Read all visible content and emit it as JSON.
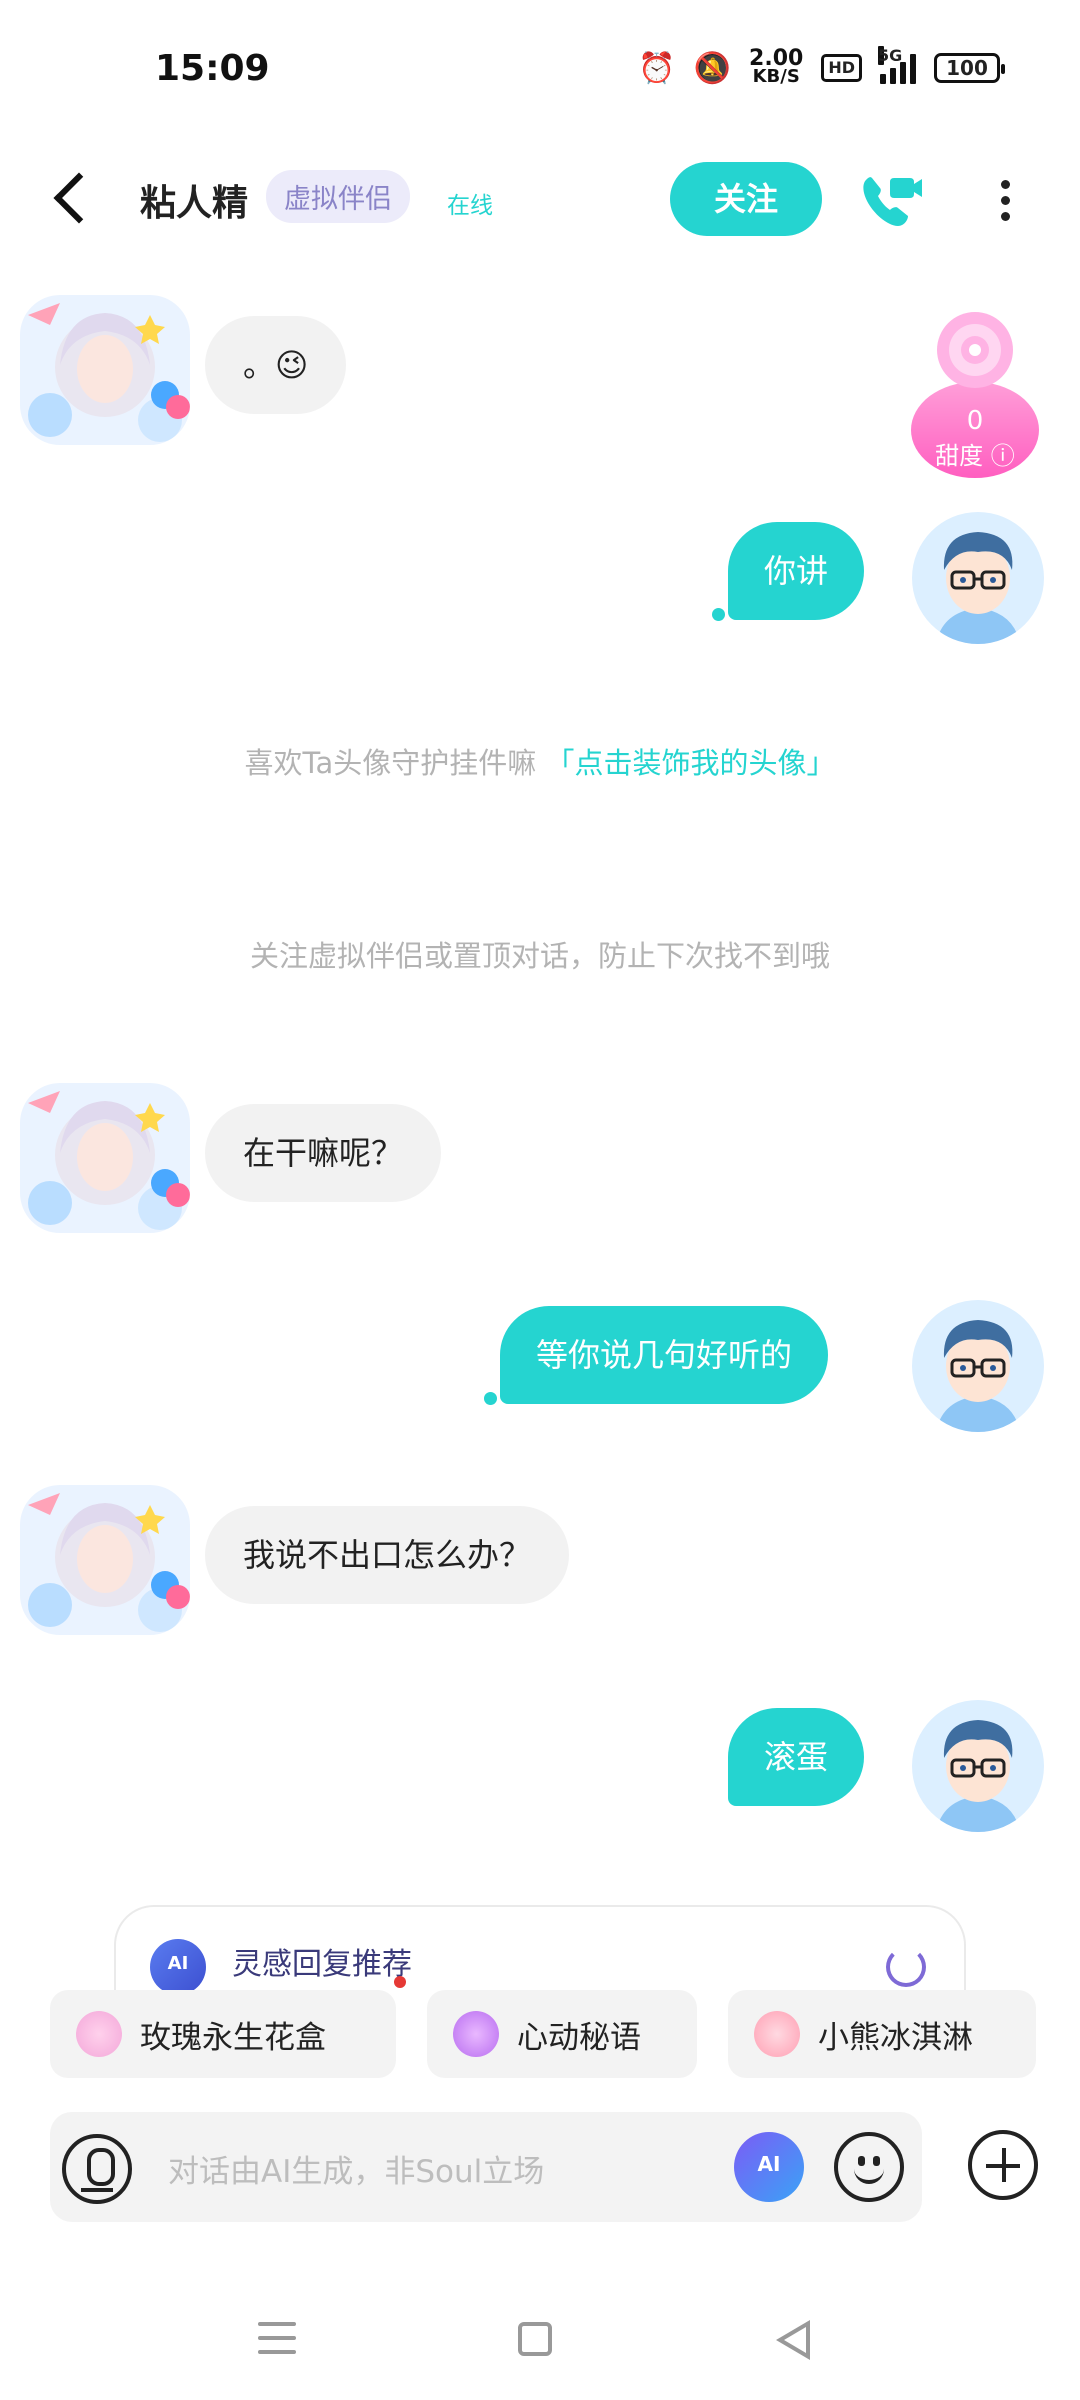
{
  "status_bar": {
    "time": "15:09",
    "speed_value": "2.00",
    "speed_unit": "KB/S",
    "hd": "HD",
    "network": "5G",
    "battery": "100"
  },
  "header": {
    "name": "粘人精",
    "tag": "虚拟伴侣",
    "status": "在线",
    "follow_label": "关注"
  },
  "sweetness": {
    "value": "0",
    "label": "甜度"
  },
  "messages": [
    {
      "side": "left",
      "text": "。😉"
    },
    {
      "side": "right",
      "text": "你讲"
    },
    {
      "side": "left",
      "text": "在干嘛呢？"
    },
    {
      "side": "right",
      "text": "等你说几句好听的"
    },
    {
      "side": "left",
      "text": "我说不出口怎么办？"
    },
    {
      "side": "right",
      "text": "滚蛋"
    }
  ],
  "system": {
    "avatar_prompt": "喜欢Ta头像守护挂件嘛",
    "avatar_link": "「点击装饰我的头像」",
    "follow_tip": "关注虚拟伴侣或置顶对话，防止下次找不到哦"
  },
  "suggestion": {
    "title": "灵感回复推荐"
  },
  "gifts": [
    {
      "label": "玫瑰永生花盒",
      "icon": "rose-box-icon"
    },
    {
      "label": "心动秘语",
      "icon": "heart-icon"
    },
    {
      "label": "小熊冰淇淋",
      "icon": "ice-cream-icon"
    }
  ],
  "input": {
    "placeholder": "对话由AI生成，非Soul立场"
  },
  "colors": {
    "accent": "#25d4d0",
    "tag_bg": "#ecebfa",
    "tag_text": "#8a84c8",
    "bubble_left": "#f2f2f2"
  }
}
